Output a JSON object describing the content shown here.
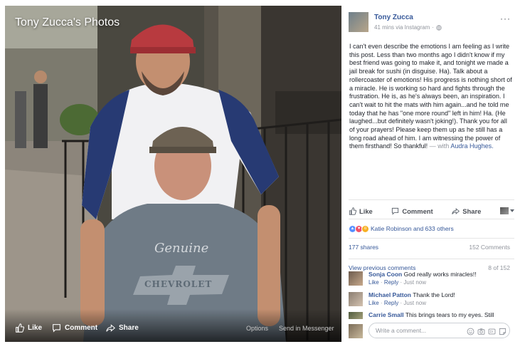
{
  "photo": {
    "album_title": "Tony Zucca's Photos",
    "shirt_text_1": "Genuine",
    "shirt_text_2": "CHEVROLET",
    "like_label": "Like",
    "comment_label": "Comment",
    "share_label": "Share",
    "options_label": "Options",
    "send_label": "Send in Messenger"
  },
  "post": {
    "author": "Tony Zucca",
    "timestamp": "41 mins via Instagram",
    "separator": "·",
    "more": "···",
    "text": "I can't even describe the emotions I am feeling as I write this post. Less than two months ago I didn't know if my best friend was going to make it, and tonight we made a jail break for sushi (in disguise. Ha). Talk about a rollercoaster of emotions! His progress is nothing short of a miracle. He is working so hard and fights through the frustration. He is, as he's always been, an inspiration. I can't wait to hit the mats with him again...and he told me today that he has \"one more round\" left in him! Ha. (He laughed...but definitely wasn't joking!). Thank you for all of your prayers! Please keep them up as he still has a long road ahead of him. I am witnessing the power of them firsthand! So thankful!",
    "with_label": "— with",
    "tagged": "Audra Hughes."
  },
  "actions": {
    "like": "Like",
    "comment": "Comment",
    "share": "Share"
  },
  "reactions": {
    "summary": "Katie Robinson and 633 others"
  },
  "stats": {
    "shares": "177 shares",
    "comments": "152 Comments"
  },
  "comments_nav": {
    "view_previous": "View previous comments",
    "pagination": "8 of 152"
  },
  "comments": [
    {
      "author": "Sonja Coon",
      "text": "God really works miracles!!",
      "like": "Like",
      "reply": "Reply",
      "time": "Just now",
      "dot": "·"
    },
    {
      "author": "Michael Patton",
      "text": "Thank the Lord!",
      "like": "Like",
      "reply": "Reply",
      "time": "Just now",
      "dot": "·"
    },
    {
      "author": "Carrie Small",
      "text": "This brings tears to my eyes. Still"
    }
  ],
  "composer": {
    "placeholder": "Write a comment..."
  },
  "colors": {
    "link": "#365899",
    "muted": "#90949c",
    "text": "#1d2129",
    "like_reaction": "#5890ff",
    "love_reaction": "#f25268",
    "wow_reaction": "#f7b125"
  }
}
